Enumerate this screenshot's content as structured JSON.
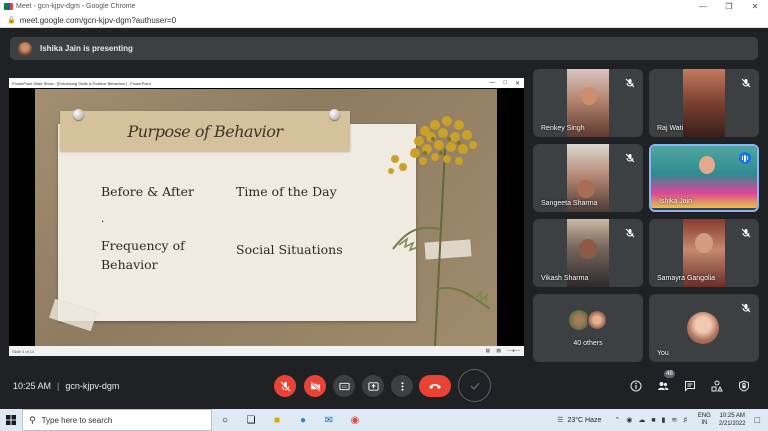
{
  "window": {
    "title": "Meet - gcn-kjpv-dgm - Google Chrome",
    "url": "meet.google.com/gcn-kjpv-dgm?authuser=0"
  },
  "presenting": {
    "text": "Ishika Jain is presenting"
  },
  "shared_screen": {
    "app_title": "PowerPoint Slide Show - [Enhancing Skills & Positive Behaviour] - PowerPoint",
    "status_text": "Slide 4 of 14",
    "slide": {
      "title": "Purpose of Behavior",
      "items": [
        "Before & After",
        "Time of the Day",
        "Frequency of Behavior",
        "Social Situations"
      ],
      "bullet_dot": "."
    }
  },
  "participants": [
    {
      "name": "Renkey Singh",
      "muted": true
    },
    {
      "name": "Raj Wati",
      "muted": true
    },
    {
      "name": "Sangeeta Sharma",
      "muted": true
    },
    {
      "name": "Ishika Jain",
      "speaking": true
    },
    {
      "name": "Vikash Sharma",
      "muted": true
    },
    {
      "name": "Samayra Gangolia",
      "muted": true
    },
    {
      "name": "40 others"
    },
    {
      "name": "You",
      "muted": true
    }
  ],
  "controls": {
    "time": "10:25 AM",
    "meeting_code": "gcn-kjpv-dgm",
    "people_count": "48"
  },
  "taskbar": {
    "search_placeholder": "Type here to search",
    "weather": "23°C  Haze",
    "language": "ENG",
    "region": "IN",
    "time": "10:25 AM",
    "date": "2/21/2022"
  },
  "colors": {
    "meet_bg": "#202124",
    "tile_bg": "#3c4043",
    "red": "#ea4335",
    "active_border": "#8ab4f8",
    "taskbar_bg": "#ddeaf4"
  }
}
